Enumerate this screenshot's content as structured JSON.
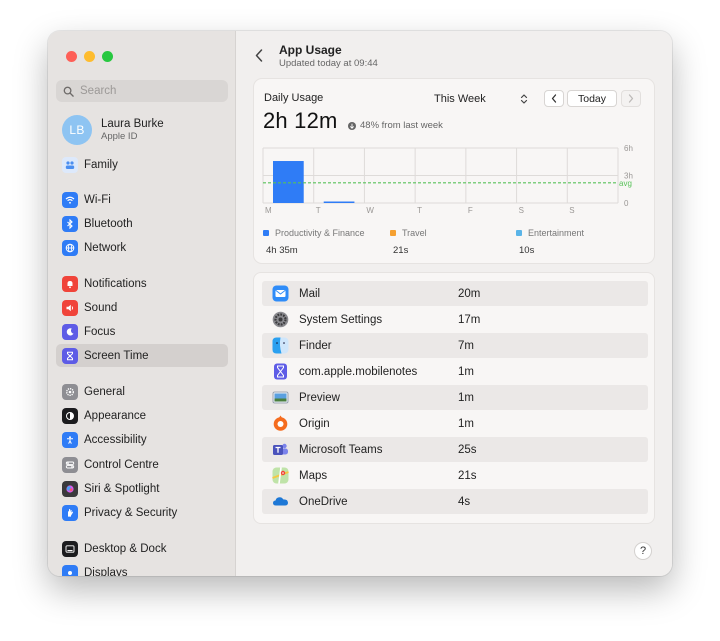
{
  "sidebar": {
    "search_placeholder": "Search",
    "profile": {
      "initials": "LB",
      "name": "Laura Burke",
      "subtitle": "Apple ID"
    },
    "items": [
      {
        "label": "Family",
        "icon": "family-icon",
        "color": "#5b9cf0"
      },
      {
        "label": "Wi-Fi",
        "icon": "wifi-icon",
        "color": "#2f7cf6"
      },
      {
        "label": "Bluetooth",
        "icon": "bluetooth-icon",
        "color": "#2f7cf6"
      },
      {
        "label": "Network",
        "icon": "network-icon",
        "color": "#2f7cf6"
      },
      {
        "label": "Notifications",
        "icon": "notifications-icon",
        "color": "#f0443a"
      },
      {
        "label": "Sound",
        "icon": "sound-icon",
        "color": "#f0443a"
      },
      {
        "label": "Focus",
        "icon": "focus-icon",
        "color": "#5e5ce6"
      },
      {
        "label": "Screen Time",
        "icon": "screen-time-icon",
        "color": "#5e5ce6",
        "selected": true
      },
      {
        "label": "General",
        "icon": "general-icon",
        "color": "#8e8e93"
      },
      {
        "label": "Appearance",
        "icon": "appearance-icon",
        "color": "#1c1c1e"
      },
      {
        "label": "Accessibility",
        "icon": "accessibility-icon",
        "color": "#2f7cf6"
      },
      {
        "label": "Control Centre",
        "icon": "control-centre-icon",
        "color": "#8e8e93"
      },
      {
        "label": "Siri & Spotlight",
        "icon": "siri-icon",
        "color": "#3a3a3c"
      },
      {
        "label": "Privacy & Security",
        "icon": "privacy-icon",
        "color": "#2f7cf6"
      },
      {
        "label": "Desktop & Dock",
        "icon": "desktop-dock-icon",
        "color": "#1c1c1e"
      },
      {
        "label": "Displays",
        "icon": "displays-icon",
        "color": "#2f7cf6"
      }
    ]
  },
  "main": {
    "title": "App Usage",
    "subtitle": "Updated today at 09:44",
    "daily_usage_label": "Daily Usage",
    "daily_usage_value": "2h 12m",
    "change_text": "48% from last week",
    "period": "This Week",
    "today_button": "Today",
    "legend": [
      {
        "label": "Productivity & Finance",
        "value": "4h 35m",
        "color": "#2f7cf6"
      },
      {
        "label": "Travel",
        "value": "21s",
        "color": "#f5a031"
      },
      {
        "label": "Entertainment",
        "value": "10s",
        "color": "#5ab4e8"
      }
    ],
    "apps": [
      {
        "name": "Mail",
        "time": "20m",
        "icon": "mail-icon"
      },
      {
        "name": "System Settings",
        "time": "17m",
        "icon": "system-settings-icon"
      },
      {
        "name": "Finder",
        "time": "7m",
        "icon": "finder-icon"
      },
      {
        "name": "com.apple.mobilenotes",
        "time": "1m",
        "icon": "hourglass-icon"
      },
      {
        "name": "Preview",
        "time": "1m",
        "icon": "preview-icon"
      },
      {
        "name": "Origin",
        "time": "1m",
        "icon": "origin-icon"
      },
      {
        "name": "Microsoft Teams",
        "time": "25s",
        "icon": "teams-icon"
      },
      {
        "name": "Maps",
        "time": "21s",
        "icon": "maps-icon"
      },
      {
        "name": "OneDrive",
        "time": "4s",
        "icon": "onedrive-icon"
      }
    ],
    "help_label": "?"
  },
  "chart_data": {
    "type": "bar",
    "categories": [
      "M",
      "T",
      "W",
      "T",
      "F",
      "S",
      "S"
    ],
    "series": [
      {
        "name": "Productivity & Finance",
        "values": [
          4.58,
          0.08,
          0,
          0,
          0,
          0,
          0
        ],
        "color": "#2f7cf6"
      }
    ],
    "ylim": [
      0,
      6
    ],
    "y_ticks": [
      "6h",
      "3h",
      "0"
    ],
    "average_label": "avg",
    "average_value": 2.2,
    "grid": true
  }
}
